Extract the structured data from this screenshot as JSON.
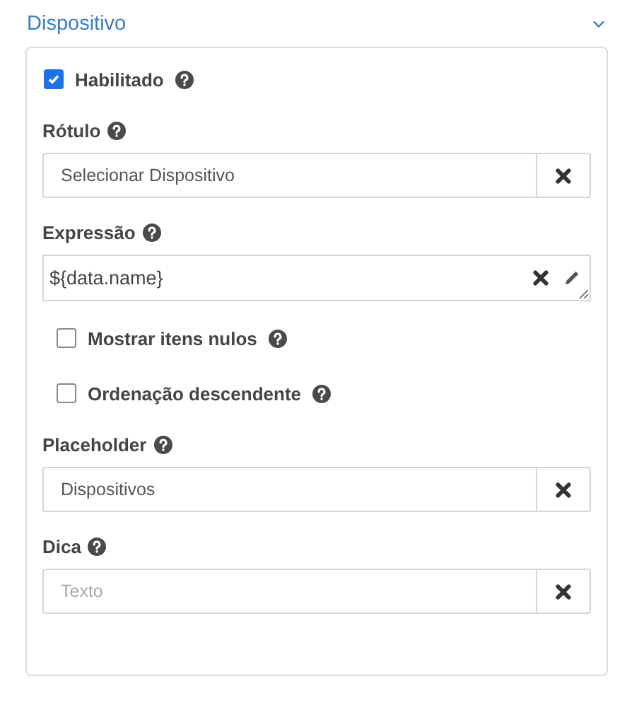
{
  "section": {
    "title": "Dispositivo",
    "expanded": true
  },
  "fields": [
    {
      "kind": "checkbox",
      "label": "Habilitado",
      "checked": true
    },
    {
      "kind": "input",
      "label": "Rótulo",
      "value": "Selecionar Dispositivo"
    },
    {
      "kind": "textarea",
      "label": "Expressão",
      "value": "${data.name}"
    },
    {
      "kind": "option",
      "label": "Mostrar itens nulos",
      "checked": false
    },
    {
      "kind": "option",
      "label": "Ordenação descendente",
      "checked": false
    },
    {
      "kind": "input",
      "label": "Placeholder",
      "value": "Dispositivos"
    },
    {
      "kind": "input",
      "label": "Dica",
      "placeholder": "Texto"
    }
  ]
}
